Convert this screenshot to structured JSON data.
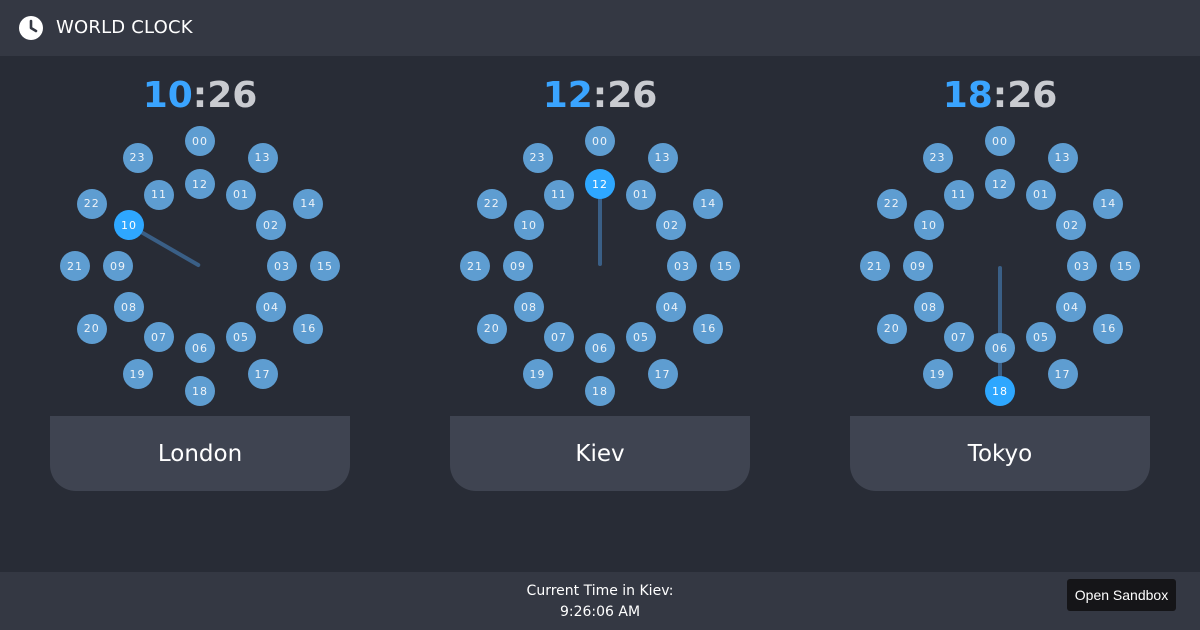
{
  "header": {
    "title": "WORLD CLOCK",
    "icon": "clock-icon"
  },
  "clocks": [
    {
      "city": "London",
      "hour": "10",
      "separator": ":",
      "minute": "26",
      "active_hour": 10
    },
    {
      "city": "Kiev",
      "hour": "12",
      "separator": ":",
      "minute": "26",
      "active_hour": 12
    },
    {
      "city": "Tokyo",
      "hour": "18",
      "separator": ":",
      "minute": "26",
      "active_hour": 18
    }
  ],
  "hour_labels": [
    "00",
    "01",
    "02",
    "03",
    "04",
    "05",
    "06",
    "07",
    "08",
    "09",
    "10",
    "11",
    "12",
    "13",
    "14",
    "15",
    "16",
    "17",
    "18",
    "19",
    "20",
    "21",
    "22",
    "23"
  ],
  "footer": {
    "status_label": "Current Time in Kiev:",
    "status_time": "9:26:06 AM",
    "sandbox_label": "Open Sandbox"
  },
  "colors": {
    "background": "#282c36",
    "bar": "#343843",
    "card": "#3f4451",
    "hour_dot": "#5e9dd1",
    "active_dot": "#2ea7ff",
    "accent_hour": "#3aa4ff"
  }
}
